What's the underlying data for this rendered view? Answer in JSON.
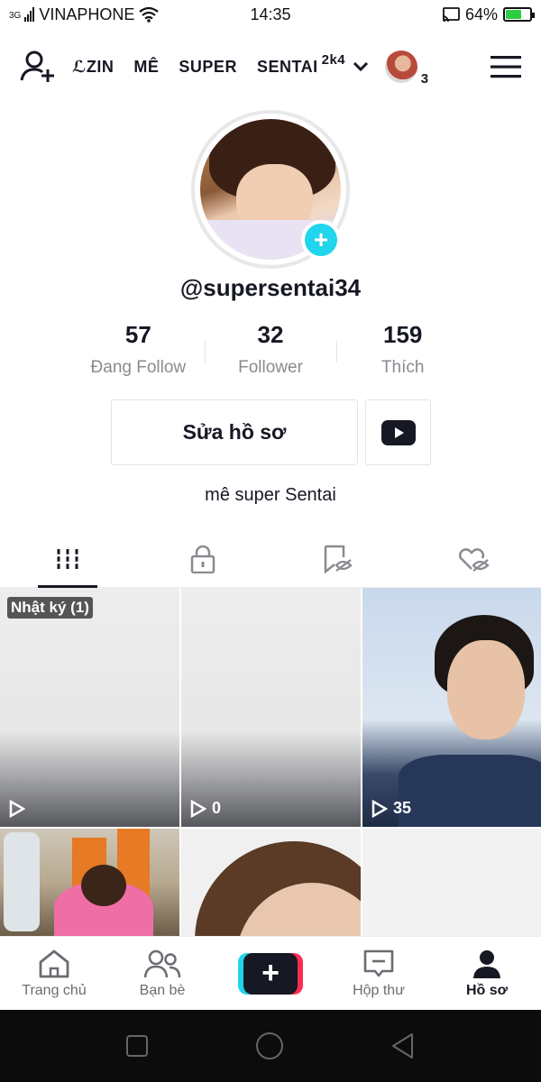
{
  "status_bar": {
    "network": "3G",
    "carrier": "VINAPHONE",
    "time": "14:35",
    "battery": "64%",
    "battery_level": 0.64
  },
  "top_nav": {
    "nick_parts": [
      "ℒZIN",
      "MÊ",
      "SUPER",
      "SENTAI"
    ],
    "nick_suffix": "2k4",
    "account_count": "3",
    "icons": [
      "add-user-icon",
      "chevron-down-icon",
      "menu-icon"
    ]
  },
  "profile": {
    "username": "@supersentai34",
    "stats": [
      {
        "value": "57",
        "label": "Đang Follow"
      },
      {
        "value": "32",
        "label": "Follower"
      },
      {
        "value": "159",
        "label": "Thích"
      }
    ],
    "edit_button": "Sửa hồ sơ",
    "bio": "mê super Sentai"
  },
  "tabs": [
    "videos-grid-icon",
    "lock-icon",
    "bookmark-hidden-icon",
    "liked-hidden-icon"
  ],
  "videos": {
    "draft_label": "Nhật ký (1)",
    "items": [
      {
        "views": ""
      },
      {
        "views": "0"
      },
      {
        "views": "35"
      }
    ]
  },
  "bottom_nav": {
    "home": "Trang chủ",
    "friends": "Bạn bè",
    "inbox": "Hộp thư",
    "profile": "Hồ sơ"
  },
  "colors": {
    "accent_cyan": "#20d5ec",
    "accent_red": "#fe2c55",
    "text": "#161823",
    "battery_green": "#2ecc40"
  }
}
